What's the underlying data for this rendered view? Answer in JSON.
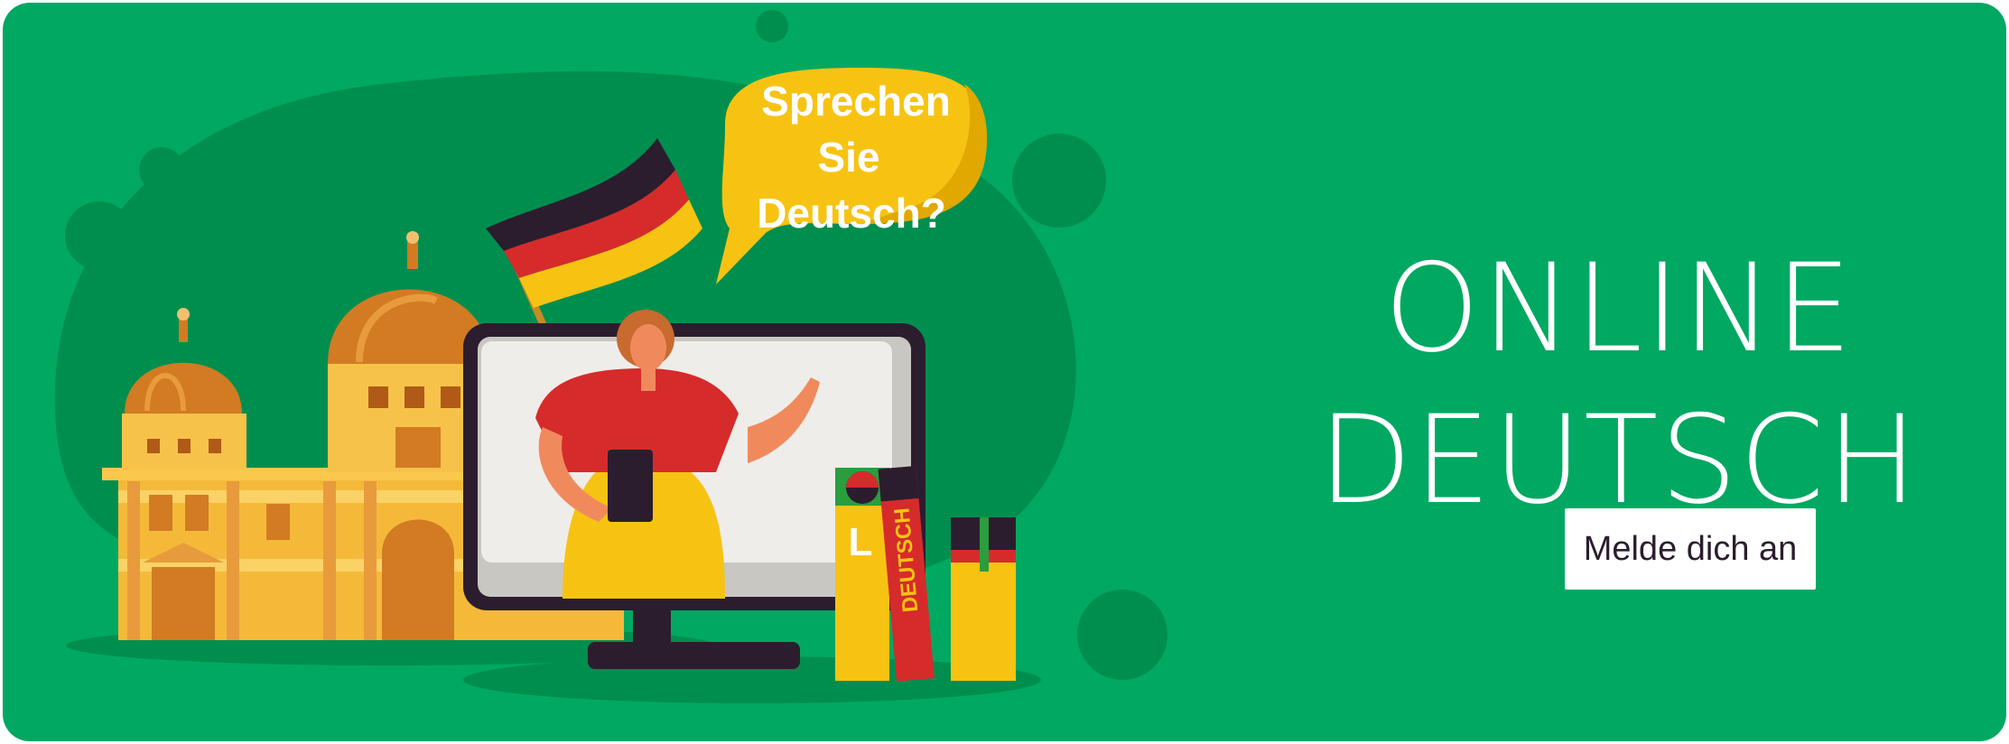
{
  "banner": {
    "title_line1": "ONLINE",
    "title_line2": "DEUTSCH",
    "cta_label": "Melde dich an"
  },
  "illustration": {
    "speech_bubble": [
      "Sprechen",
      "Sie",
      "Deutsch?"
    ],
    "book_spine_text": "DEUTSCH",
    "book_letter": "L"
  },
  "colors": {
    "background": "#00a862",
    "background_dark": "#008e4f",
    "bubble": "#f7c313",
    "title": "#ffffff",
    "button_bg": "#ffffff",
    "button_text": "#2b1d2e"
  },
  "icons": [
    "german-flag-icon",
    "computer-monitor-icon",
    "speech-bubble-icon",
    "book-icon",
    "building-icon"
  ]
}
